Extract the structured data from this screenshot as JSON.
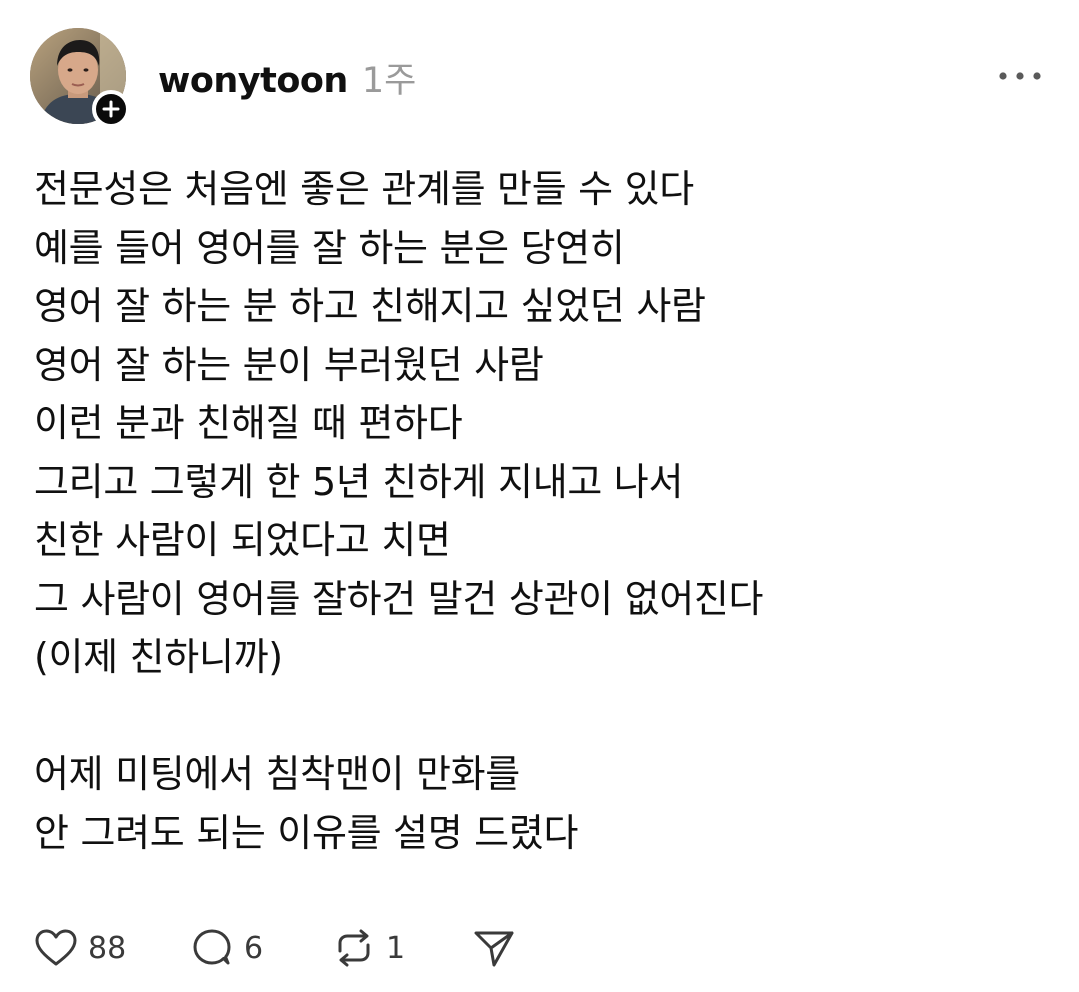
{
  "post": {
    "author": {
      "username": "wonytoon",
      "avatar_icon": "profile-photo",
      "follow_icon": "plus-icon"
    },
    "timestamp": "1주",
    "menu_icon": "more-icon",
    "body_lines": [
      "전문성은 처음엔 좋은 관계를 만들 수 있다",
      "예를 들어 영어를 잘 하는 분은 당연히",
      "영어 잘 하는 분 하고 친해지고 싶었던 사람",
      "영어 잘 하는 분이 부러웠던 사람",
      "이런 분과 친해질 때 편하다",
      "그리고 그렇게 한 5년 친하게 지내고 나서",
      "친한 사람이 되었다고 치면",
      "그 사람이 영어를 잘하건 말건 상관이 없어진다",
      "(이제 친하니까)",
      "",
      "어제 미팅에서 침착맨이 만화를",
      "안 그려도 되는 이유를 설명 드렸다"
    ],
    "actions": {
      "like": {
        "icon": "heart-icon",
        "count": "88"
      },
      "comment": {
        "icon": "comment-icon",
        "count": "6"
      },
      "repost": {
        "icon": "repost-icon",
        "count": "1"
      },
      "share": {
        "icon": "send-icon"
      }
    }
  },
  "colors": {
    "text": "#101010",
    "muted": "#9a9a9a",
    "icon": "#3a3a3a"
  }
}
